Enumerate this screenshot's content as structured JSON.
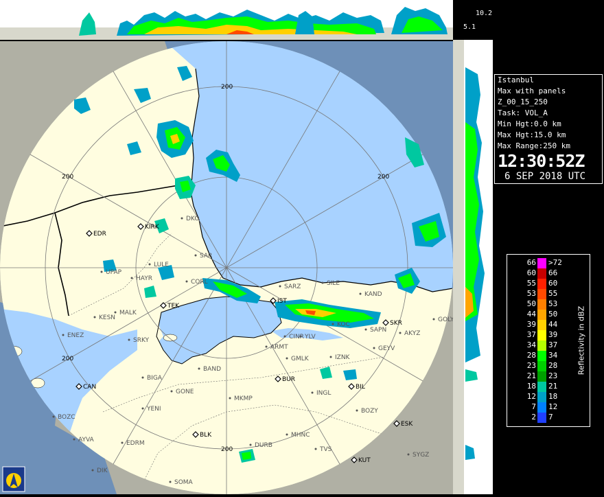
{
  "header": {
    "top_max_hgt": "10.2",
    "top_min_hgt": "5.1"
  },
  "info": {
    "station": "Istanbul",
    "product": "Max with panels",
    "product_code": "Z_00_15_250",
    "task": "Task: VOL_A",
    "min_hgt": "Min Hgt:0.0 km",
    "max_hgt": "Max Hgt:15.0 km",
    "max_range": "Max Range:250 km",
    "time": "12:30:52Z",
    "date": "6 SEP 2018 UTC"
  },
  "legend": {
    "title": "Reflectivity in dBZ",
    "rows": [
      {
        "lo": "66",
        "hi": ">72",
        "color": "#ff00ff"
      },
      {
        "lo": "60",
        "hi": "66",
        "color": "#c80000"
      },
      {
        "lo": "55",
        "hi": "60",
        "color": "#ff2000"
      },
      {
        "lo": "53",
        "hi": "55",
        "color": "#ff4a00"
      },
      {
        "lo": "50",
        "hi": "53",
        "color": "#ff8000"
      },
      {
        "lo": "44",
        "hi": "50",
        "color": "#ffa500"
      },
      {
        "lo": "39",
        "hi": "44",
        "color": "#ffd000"
      },
      {
        "lo": "37",
        "hi": "39",
        "color": "#ffff00"
      },
      {
        "lo": "34",
        "hi": "37",
        "color": "#b4ff00"
      },
      {
        "lo": "28",
        "hi": "34",
        "color": "#00ff00"
      },
      {
        "lo": "23",
        "hi": "28",
        "color": "#00d000"
      },
      {
        "lo": "21",
        "hi": "23",
        "color": "#00a000"
      },
      {
        "lo": "18",
        "hi": "21",
        "color": "#00c8a0"
      },
      {
        "lo": "12",
        "hi": "18",
        "color": "#00a0c8"
      },
      {
        "lo": "7",
        "hi": "12",
        "color": "#0080ff"
      },
      {
        "lo": "2",
        "hi": "7",
        "color": "#2040ff"
      }
    ]
  },
  "range_labels": [
    "200",
    "200",
    "200",
    "200",
    "200"
  ],
  "cities": [
    {
      "id": "EDR",
      "label": "EDR",
      "marker": "diamond"
    },
    {
      "id": "KIRK",
      "label": "KIRK",
      "marker": "diamond"
    },
    {
      "id": "DKO",
      "label": "DKO",
      "marker": "dot"
    },
    {
      "id": "SAR",
      "label": "SAR",
      "marker": "dot"
    },
    {
      "id": "LULE",
      "label": "LULE",
      "marker": "dot"
    },
    {
      "id": "CORL",
      "label": "CORL",
      "marker": "dot"
    },
    {
      "id": "HAYR",
      "label": "HAYR",
      "marker": "dot"
    },
    {
      "id": "UPAP",
      "label": "UPAP",
      "marker": "dot"
    },
    {
      "id": "TEK",
      "label": "TEK",
      "marker": "diamond"
    },
    {
      "id": "MALK",
      "label": "MALK",
      "marker": "dot"
    },
    {
      "id": "KESN",
      "label": "KESN",
      "marker": "dot"
    },
    {
      "id": "ENEZ",
      "label": "ENEZ",
      "marker": "dot"
    },
    {
      "id": "SRKY",
      "label": "SRKY",
      "marker": "dot"
    },
    {
      "id": "IST",
      "label": "IST",
      "marker": "diamond"
    },
    {
      "id": "SARZ",
      "label": "SARZ",
      "marker": "dot"
    },
    {
      "id": "SILE",
      "label": "SILE",
      "marker": "dot"
    },
    {
      "id": "KAND",
      "label": "KAND",
      "marker": "dot"
    },
    {
      "id": "KOC",
      "label": "KOC",
      "marker": "dot"
    },
    {
      "id": "SKR",
      "label": "SKR",
      "marker": "diamond"
    },
    {
      "id": "SAPN",
      "label": "SAPN",
      "marker": "dot"
    },
    {
      "id": "AKYZ",
      "label": "AKYZ",
      "marker": "dot"
    },
    {
      "id": "GOLY",
      "label": "GOLY",
      "marker": "dot"
    },
    {
      "id": "YLV",
      "label": "YLV",
      "marker": "dot"
    },
    {
      "id": "CINR",
      "label": "CINR",
      "marker": "dot"
    },
    {
      "id": "IZNK",
      "label": "IZNK",
      "marker": "dot"
    },
    {
      "id": "GEYV",
      "label": "GEYV",
      "marker": "dot"
    },
    {
      "id": "ARMT",
      "label": "ARMT",
      "marker": "dot"
    },
    {
      "id": "GMLK",
      "label": "GMLK",
      "marker": "dot"
    },
    {
      "id": "BAND",
      "label": "BAND",
      "marker": "dot"
    },
    {
      "id": "BUR",
      "label": "BUR",
      "marker": "diamond"
    },
    {
      "id": "BIL",
      "label": "BIL",
      "marker": "diamond"
    },
    {
      "id": "INGL",
      "label": "INGL",
      "marker": "dot"
    },
    {
      "id": "BIGA",
      "label": "BIGA",
      "marker": "dot"
    },
    {
      "id": "GONE",
      "label": "GONE",
      "marker": "dot"
    },
    {
      "id": "CAN",
      "label": "CAN",
      "marker": "diamond"
    },
    {
      "id": "MKMP",
      "label": "MKMP",
      "marker": "dot"
    },
    {
      "id": "BOZY",
      "label": "BOZY",
      "marker": "dot"
    },
    {
      "id": "YENI",
      "label": "YENI",
      "marker": "dot"
    },
    {
      "id": "ESK",
      "label": "ESK",
      "marker": "diamond"
    },
    {
      "id": "BOZC",
      "label": "BOZC",
      "marker": "dot"
    },
    {
      "id": "AYVA",
      "label": "AYVA",
      "marker": "dot"
    },
    {
      "id": "EDRM",
      "label": "EDRM",
      "marker": "dot"
    },
    {
      "id": "BLK",
      "label": "BLK",
      "marker": "diamond"
    },
    {
      "id": "MHNC",
      "label": "MHNC",
      "marker": "dot"
    },
    {
      "id": "DURB",
      "label": "DURB",
      "marker": "dot"
    },
    {
      "id": "TVS",
      "label": "TVS",
      "marker": "dot"
    },
    {
      "id": "KUT",
      "label": "KUT",
      "marker": "diamond"
    },
    {
      "id": "SYGZ",
      "label": "SYGZ",
      "marker": "dot"
    },
    {
      "id": "SOMA",
      "label": "SOMA",
      "marker": "dot"
    },
    {
      "id": "DIK",
      "label": "DIK",
      "marker": "dot"
    }
  ],
  "colors": {
    "land": "#fffde0",
    "sea": "#a8d2ff",
    "outside": "#b0b0a4",
    "outside_sea": "#6e90b8"
  }
}
